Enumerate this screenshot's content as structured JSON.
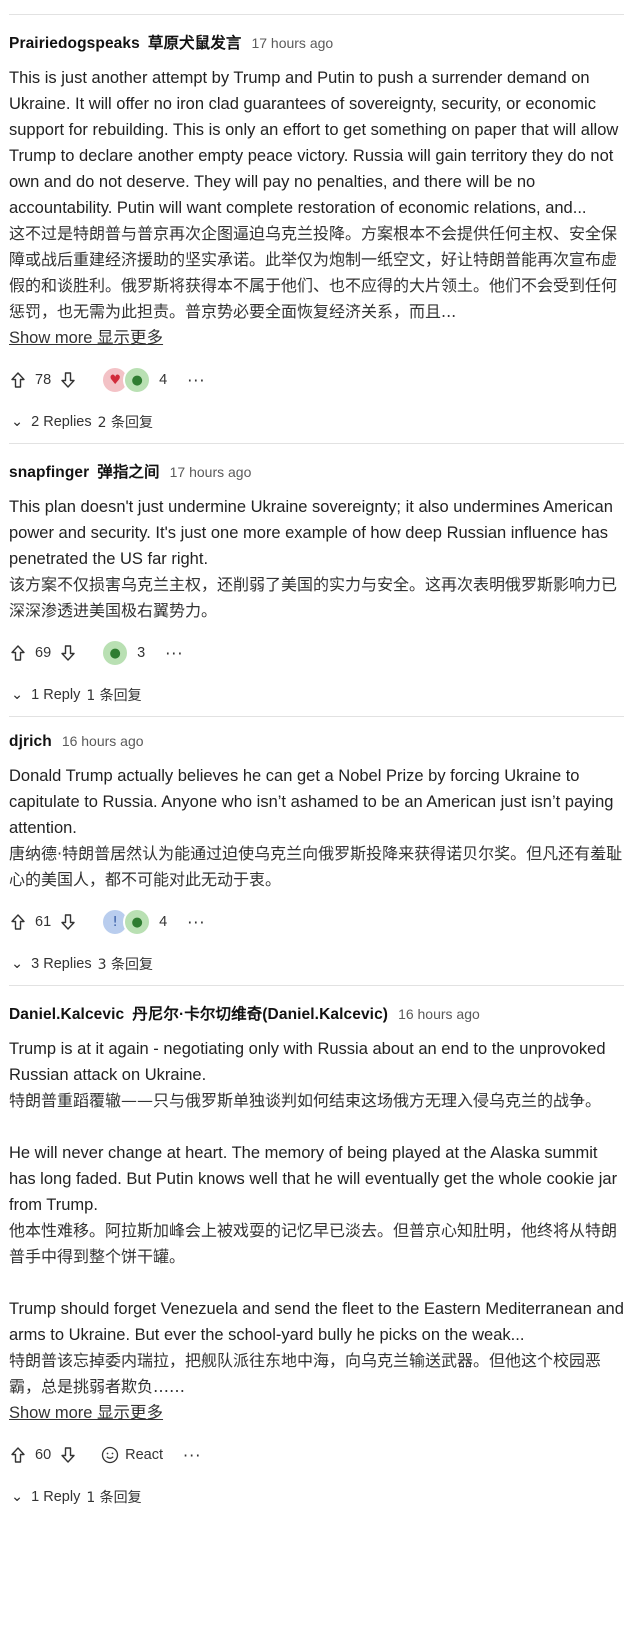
{
  "comments": [
    {
      "author": "Prairiedogspeaks",
      "author_zh": "草原犬鼠发言",
      "time": "17 hours ago",
      "paragraphs": [
        {
          "en": "This is just another attempt by Trump and Putin to push a surrender demand on Ukraine. It will offer no iron clad guarantees of sovereignty, security, or economic support for rebuilding. This is only an effort to get something on paper that will allow Trump to declare another empty peace victory. Russia will gain territory they do not own and do not deserve. They will pay no penalties, and there will be no accountability. Putin will want complete restoration of economic relations, and...",
          "zh": "这不过是特朗普与普京再次企图逼迫乌克兰投降。方案根本不会提供任何主权、安全保障或战后重建经济援助的坚实承诺。此举仅为炮制一纸空文，好让特朗普能再次宣布虚假的和谈胜利。俄罗斯将获得本不属于他们、也不应得的大片领土。他们不会受到任何惩罚，也无需为此担责。普京势必要全面恢复经济关系，而且..."
        }
      ],
      "show_more": "Show more  显示更多",
      "votes": "78",
      "reactions": [
        "heart",
        "lightbulb"
      ],
      "reaction_count": "4",
      "more": "···",
      "replies": "2 Replies",
      "replies_zh": "2 条回复"
    },
    {
      "author": "snapfinger",
      "author_zh": "弹指之间",
      "time": "17 hours ago",
      "paragraphs": [
        {
          "en": "This plan doesn't just undermine Ukraine sovereignty; it also undermines American power and security. It's just one more example of how deep Russian influence has penetrated the US far right.",
          "zh": "该方案不仅损害乌克兰主权，还削弱了美国的实力与安全。这再次表明俄罗斯影响力已深深渗透进美国极右翼势力。"
        }
      ],
      "votes": "69",
      "reactions": [
        "lightbulb"
      ],
      "reaction_count": "3",
      "more": "···",
      "replies": "1 Reply",
      "replies_zh": "1 条回复"
    },
    {
      "author": "djrich",
      "time": "16 hours ago",
      "paragraphs": [
        {
          "en": "Donald Trump actually believes he can get a Nobel Prize by forcing Ukraine to capitulate to Russia. Anyone who isn’t ashamed to be an American just isn’t paying attention.",
          "zh": "唐纳德·特朗普居然认为能通过迫使乌克兰向俄罗斯投降来获得诺贝尔奖。但凡还有羞耻心的美国人，都不可能对此无动于衷。"
        }
      ],
      "votes": "61",
      "reactions": [
        "exclamation",
        "lightbulb"
      ],
      "reaction_count": "4",
      "more": "···",
      "replies": "3 Replies",
      "replies_zh": "3 条回复"
    },
    {
      "author": "Daniel.Kalcevic",
      "author_zh": "丹尼尔·卡尔切维奇(Daniel.Kalcevic)",
      "time": "16 hours ago",
      "paragraphs": [
        {
          "en": "Trump is at it again - negotiating only with Russia about an end to the unprovoked Russian attack on Ukraine.",
          "zh": "特朗普重蹈覆辙——只与俄罗斯单独谈判如何结束这场俄方无理入侵乌克兰的战争。"
        },
        {
          "en": "He will never change at heart. The memory of being played at the Alaska summit has long faded. But Putin knows well that he will eventually get the whole cookie jar from Trump.",
          "zh": "他本性难移。阿拉斯加峰会上被戏耍的记忆早已淡去。但普京心知肚明，他终将从特朗普手中得到整个饼干罐。"
        },
        {
          "en": "Trump should forget Venezuela and send the fleet to the Eastern Mediterranean and arms to Ukraine. But ever the school-yard bully he picks on the weak...",
          "zh": "特朗普该忘掉委内瑞拉，把舰队派往东地中海，向乌克兰输送武器。但他这个校园恶霸，总是挑弱者欺负……"
        }
      ],
      "show_more": "Show more  显示更多",
      "votes": "60",
      "react_label": "React",
      "more": "···",
      "replies": "1 Reply",
      "replies_zh": "1 条回复"
    }
  ]
}
